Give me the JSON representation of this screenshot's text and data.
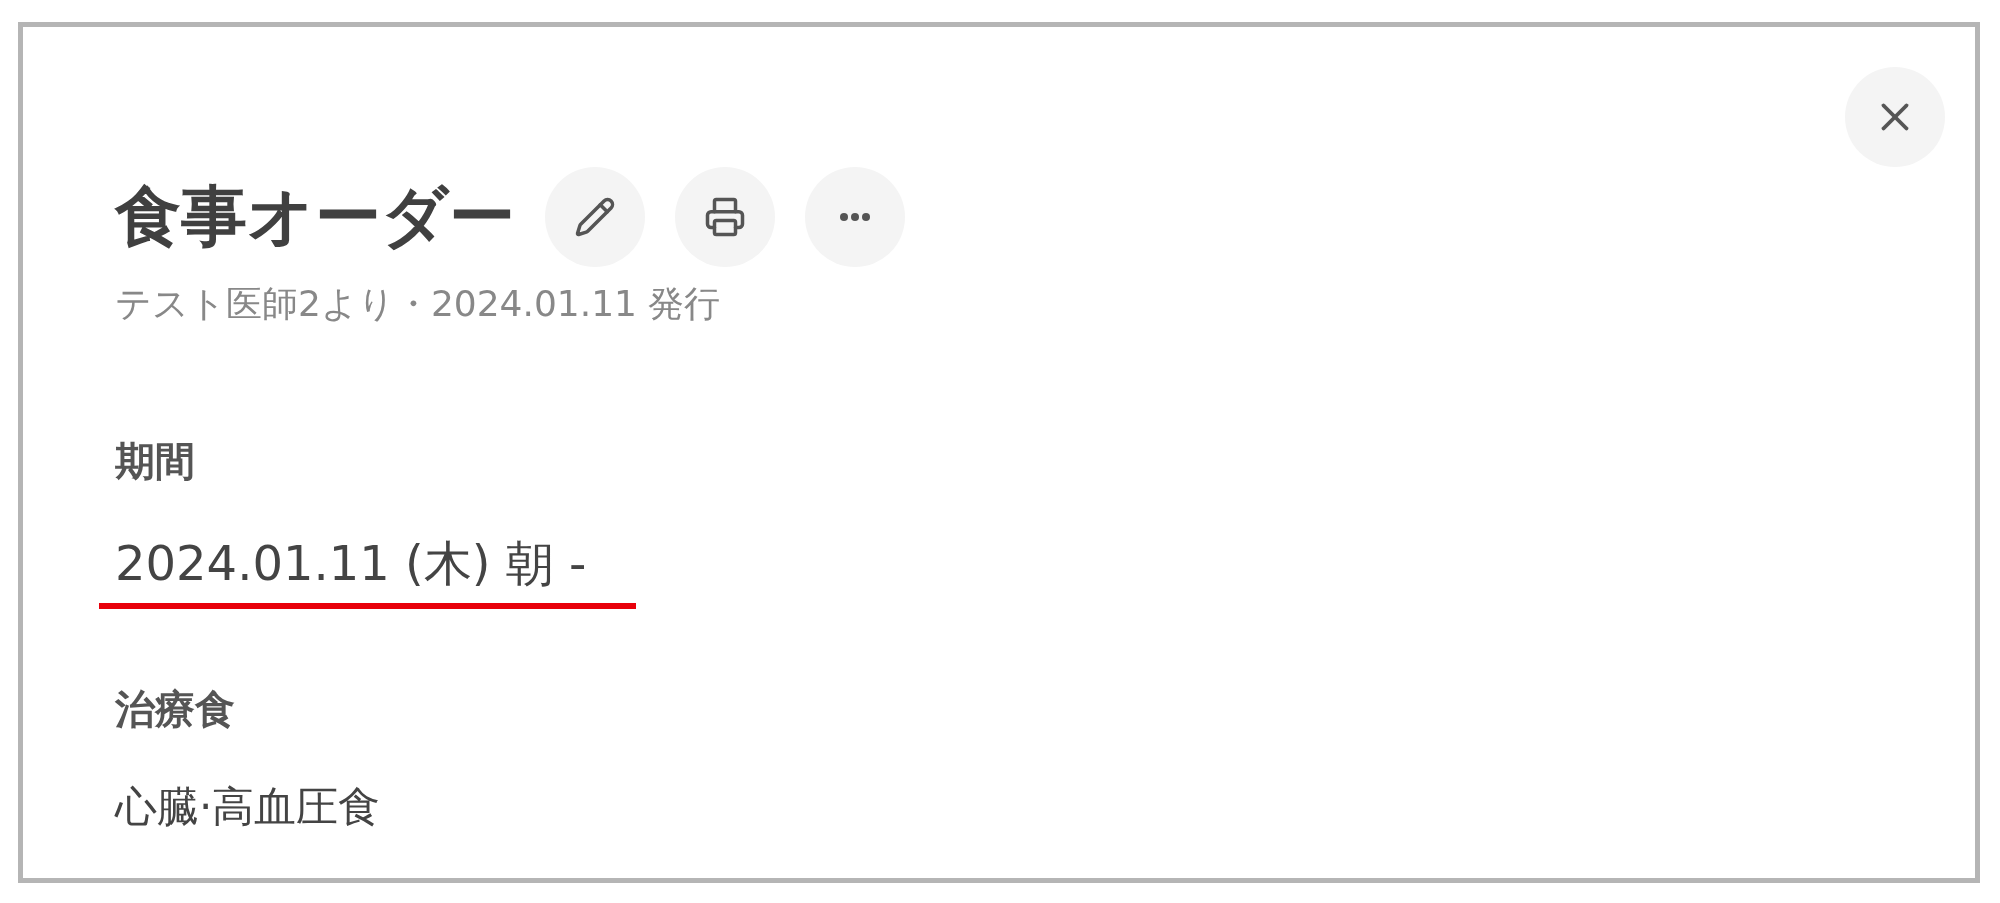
{
  "dialog": {
    "title": "食事オーダー",
    "subtitle": "テスト医師2より・2024.01.11 発行",
    "fields": [
      {
        "label": "期間",
        "value": "2024.01.11 (木) 朝 -",
        "underlined": true
      },
      {
        "label": "治療食",
        "value": "心臓·高血圧食",
        "underlined": false
      }
    ]
  }
}
